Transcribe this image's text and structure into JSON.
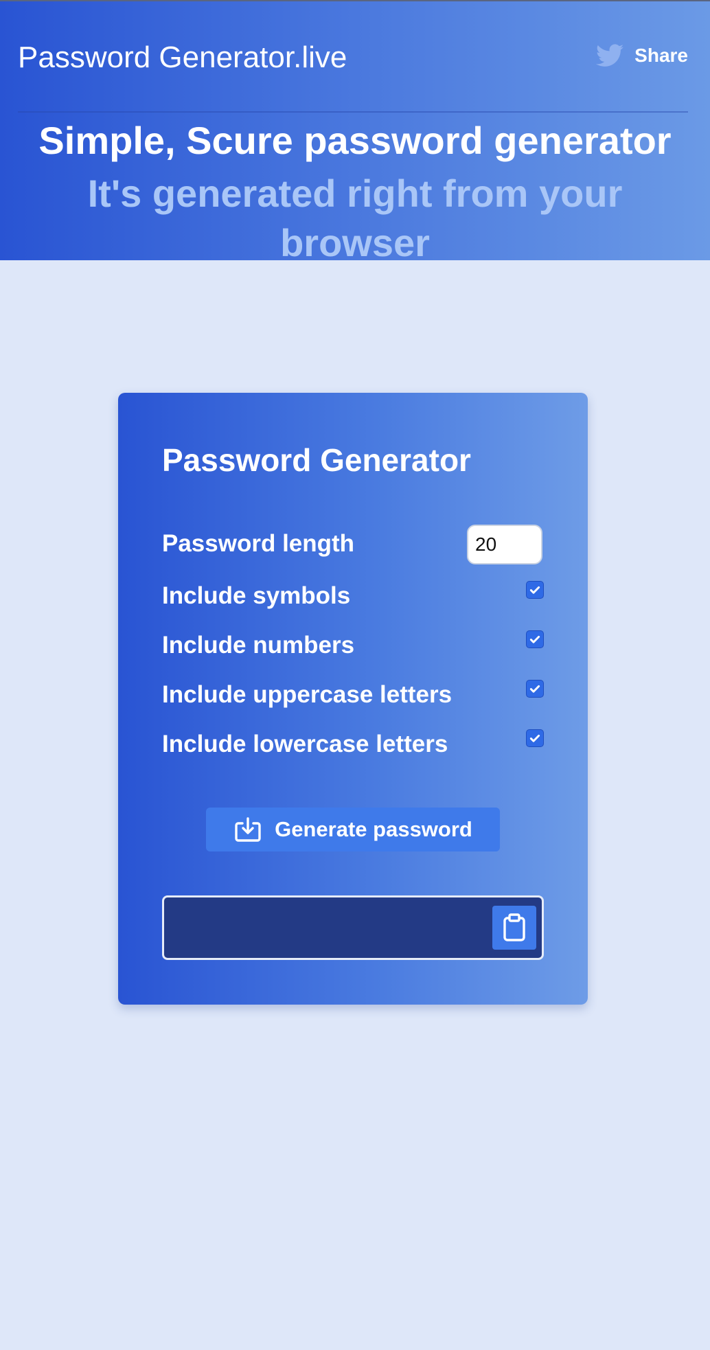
{
  "header": {
    "site_title": "Password Generator.live",
    "share_label": "Share",
    "share_icon": "twitter-bird-icon"
  },
  "hero": {
    "headline": "Simple, Scure password generator",
    "subheadline": "It's generated right from your browser"
  },
  "generator": {
    "title": "Password Generator",
    "length_label": "Password length",
    "length_value": "20",
    "options": [
      {
        "label": "Include symbols",
        "checked": true
      },
      {
        "label": "Include numbers",
        "checked": true
      },
      {
        "label": "Include uppercase letters",
        "checked": true
      },
      {
        "label": "Include lowercase letters",
        "checked": true
      }
    ],
    "generate_label": "Generate password",
    "generate_icon": "download-tray-icon",
    "output_value": "",
    "copy_icon": "clipboard-icon"
  },
  "colors": {
    "page_background": "#dee7f9",
    "gradient_start": "#2954d3",
    "gradient_end": "#6b9ae6",
    "button_blue": "#3f7aea",
    "output_background": "#233a85",
    "subheadline_text": "#a9c6f7"
  }
}
